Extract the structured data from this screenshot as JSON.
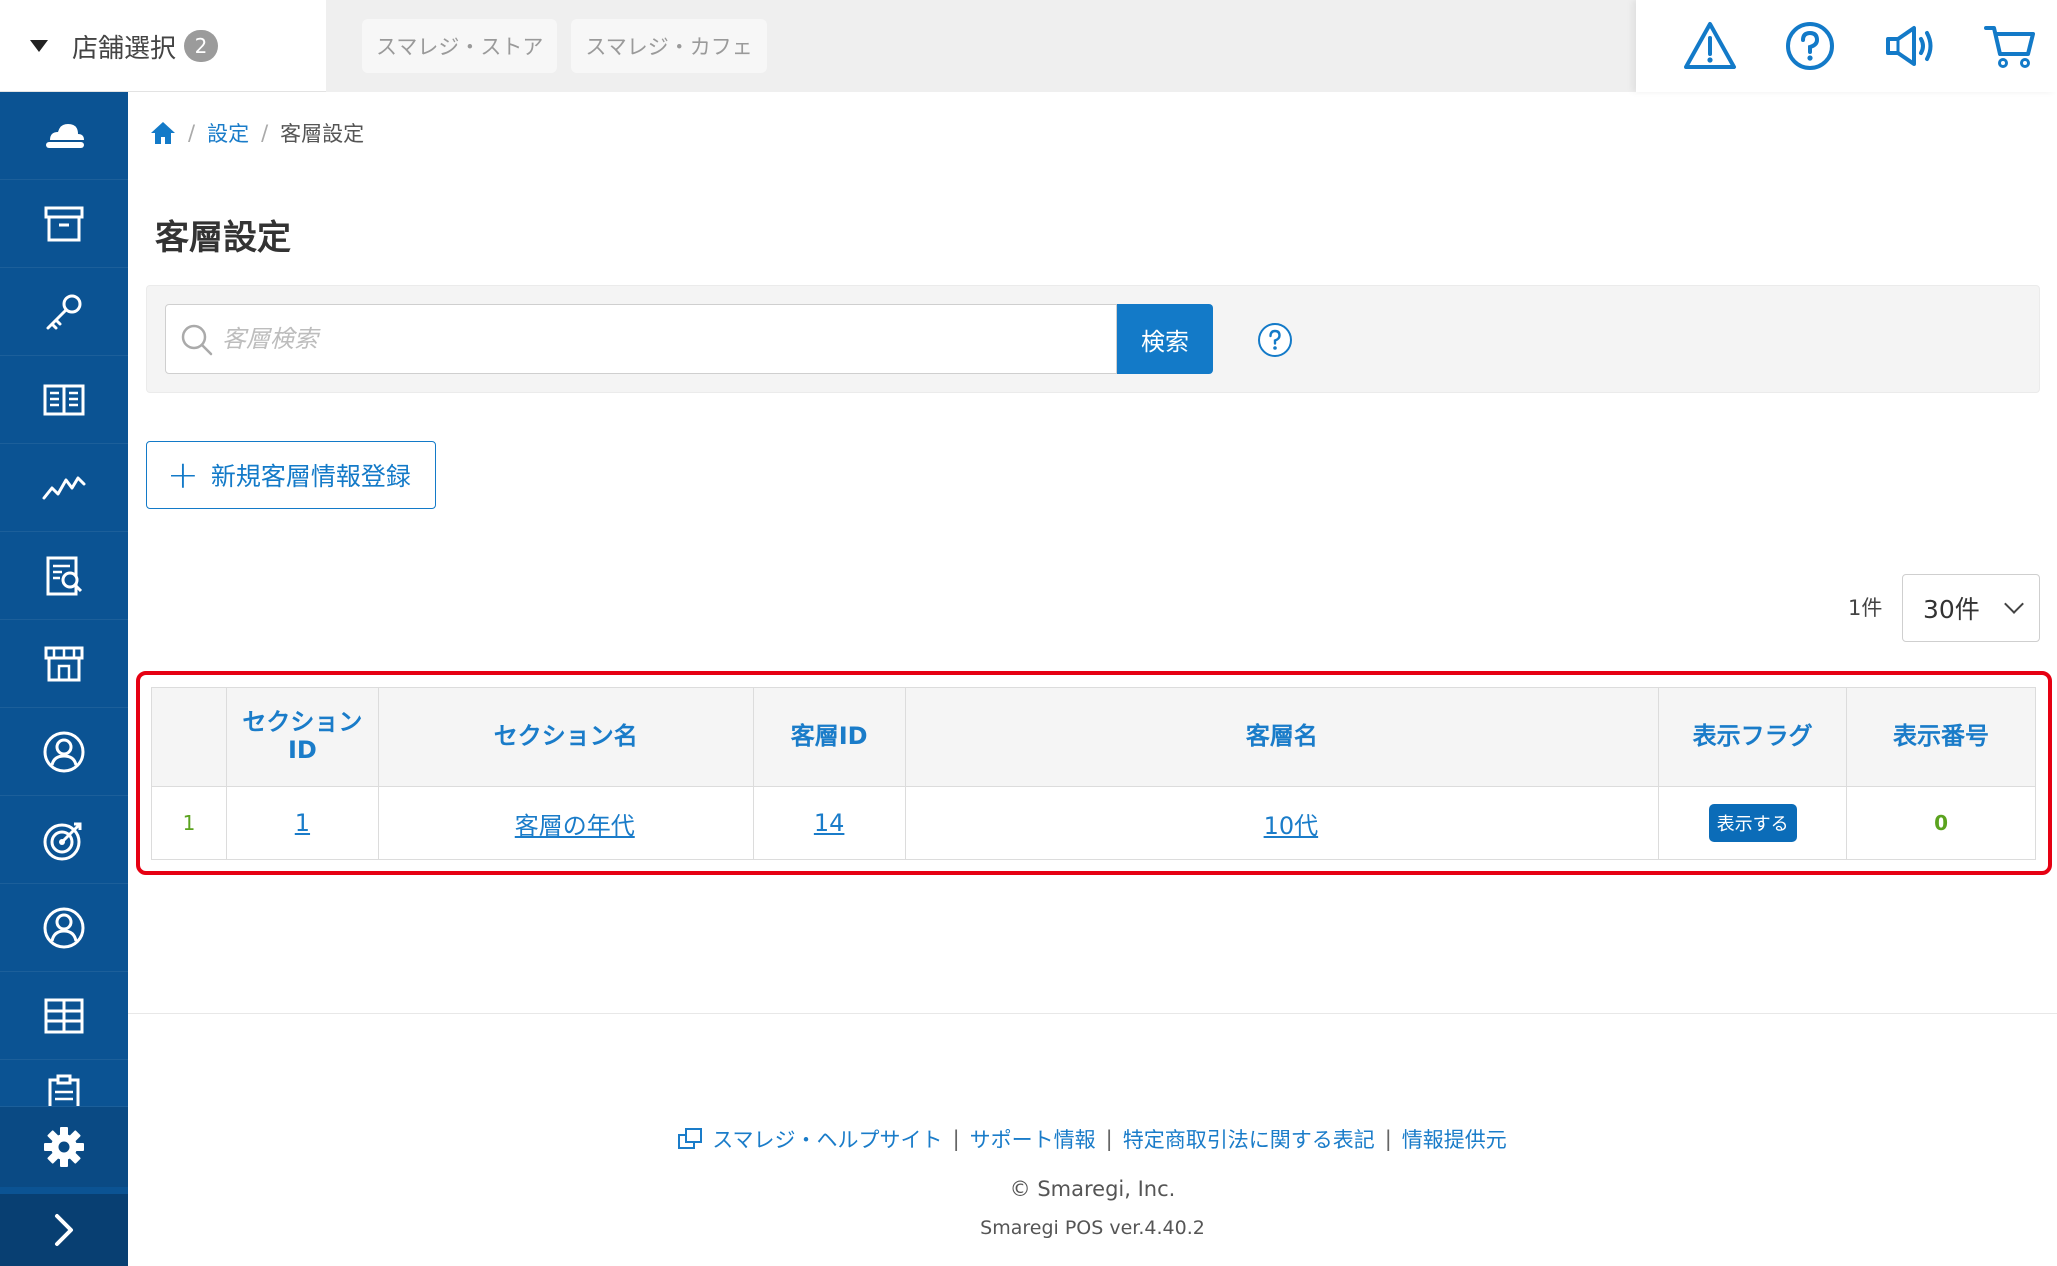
{
  "header": {
    "store_select_label": "店舗選択",
    "store_count": "2",
    "store_tabs": [
      "スマレジ・ストア",
      "スマレジ・カフェ"
    ],
    "icons": [
      "warning-icon",
      "help-icon",
      "announcement-icon",
      "cart-icon"
    ]
  },
  "sidebar": {
    "items": [
      "cloud-icon",
      "archive-icon",
      "key-icon",
      "book-icon",
      "chart-icon",
      "report-icon",
      "store-icon",
      "customer-icon",
      "target-icon",
      "staff-icon",
      "grid-icon",
      "clipboard-icon"
    ],
    "settings_icon": "gear-icon",
    "expand_icon": "chevron-right-icon"
  },
  "breadcrumb": {
    "home_icon": "home-icon",
    "level1": "設定",
    "current": "客層設定",
    "separator": "/"
  },
  "page": {
    "title": "客層設定"
  },
  "search": {
    "placeholder": "客層検索",
    "value": "",
    "button_label": "検索",
    "help_icon": "help-circle-icon"
  },
  "add_button": {
    "label": "新規客層情報登録"
  },
  "pagination": {
    "count_label": "1件",
    "per_page": "30件"
  },
  "table": {
    "headers": {
      "section_id_line1": "セクション",
      "section_id_line2": "ID",
      "section_name": "セクション名",
      "customer_group_id": "客層ID",
      "customer_group_name": "客層名",
      "display_flag": "表示フラグ",
      "display_order": "表示番号"
    },
    "rows": [
      {
        "index": "1",
        "section_id": "1",
        "section_name": "客層の年代",
        "customer_group_id": "14",
        "customer_group_name": "10代",
        "display_flag": "表示する",
        "display_order": "0"
      }
    ]
  },
  "footer": {
    "links": [
      "スマレジ・ヘルプサイト",
      "サポート情報",
      "特定商取引法に関する表記",
      "情報提供元"
    ],
    "separator": "|",
    "copyright": "© Smaregi, Inc.",
    "version": "Smaregi POS ver.4.40.2"
  },
  "colors": {
    "sidebar": "#0b5393",
    "primary": "#137ac8",
    "highlight": "#e60012",
    "accent_green": "#5ba31f"
  }
}
